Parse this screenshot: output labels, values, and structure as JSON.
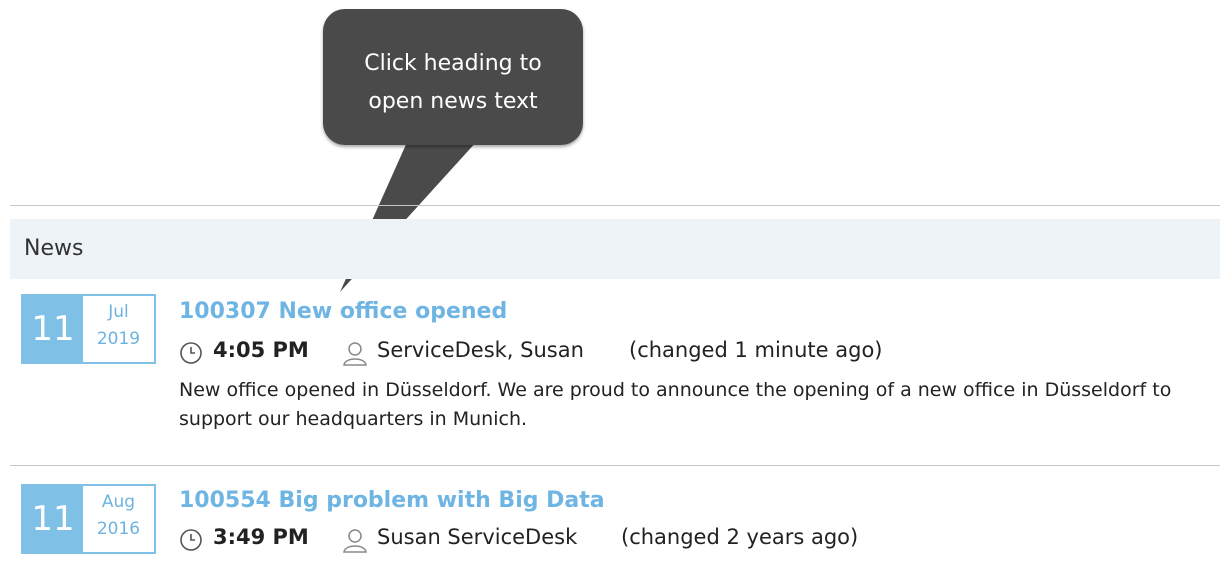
{
  "tooltip": {
    "text": "Click heading to\nopen news text"
  },
  "section": {
    "title": "News"
  },
  "news": [
    {
      "day": "11",
      "month": "Jul",
      "year": "2019",
      "headline": "100307 New office opened",
      "time": "4:05 PM",
      "author": "ServiceDesk, Susan",
      "changed": "(changed 1 minute ago)",
      "body": "New office opened in Düsseldorf. We are proud to announce the opening of a new office in Düsseldorf to support our headquarters in Munich."
    },
    {
      "day": "11",
      "month": "Aug",
      "year": "2016",
      "headline": "100554 Big problem with Big Data",
      "time": "3:49 PM",
      "author": "Susan ServiceDesk",
      "changed": "(changed 2 years ago)"
    }
  ],
  "colors": {
    "accent": "#7ec0e6",
    "link": "#6fb5e4",
    "tooltip": "#4a4a4a",
    "header_bg": "#edf3f7"
  },
  "icons": {
    "time": "clock-icon",
    "author": "user-icon"
  }
}
